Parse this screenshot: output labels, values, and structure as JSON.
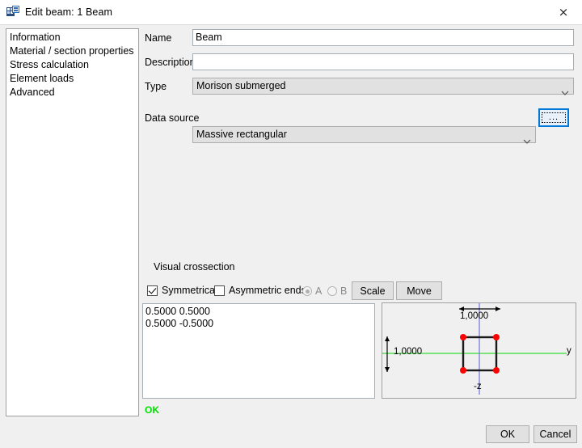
{
  "window": {
    "title": "Edit beam: 1 Beam",
    "icon": "app-icon",
    "close_label": "×"
  },
  "sidebar": {
    "items": [
      {
        "label": "Information",
        "selected": true
      },
      {
        "label": "Material / section properties",
        "selected": false
      },
      {
        "label": "Stress calculation",
        "selected": false
      },
      {
        "label": "Element loads",
        "selected": false
      },
      {
        "label": "Advanced",
        "selected": false
      }
    ]
  },
  "form": {
    "name": {
      "label": "Name",
      "value": "Beam",
      "placeholder": ""
    },
    "description": {
      "label": "Description",
      "value": "",
      "placeholder": ""
    },
    "type": {
      "label": "Type",
      "value": "Morison submerged"
    },
    "data_source": {
      "label": "Data source",
      "value": "Massive rectangular",
      "browse_label": "..."
    }
  },
  "crossection": {
    "section_title": "Visual crossection",
    "symmetrical": {
      "label": "Symmetrical",
      "checked": true
    },
    "asymmetric_ends": {
      "label": "Asymmetric ends",
      "checked": false
    },
    "radio_a": {
      "label": "A",
      "selected": true
    },
    "radio_b": {
      "label": "B",
      "selected": false
    },
    "scale_button": "Scale",
    "move_button": "Move",
    "coordinates_text": "0.5000 0.5000\n0.5000 -0.5000",
    "status": "OK"
  },
  "diagram": {
    "width_label": "1,0000",
    "height_label": "1,0000",
    "axis_y_label": "y",
    "axis_z_label": "-z",
    "colors": {
      "y_axis": "#33dd33",
      "z_axis": "#7b7bdd",
      "node": "#ff0000",
      "outline": "#1a1a1a"
    }
  },
  "footer": {
    "ok_label": "OK",
    "cancel_label": "Cancel"
  }
}
